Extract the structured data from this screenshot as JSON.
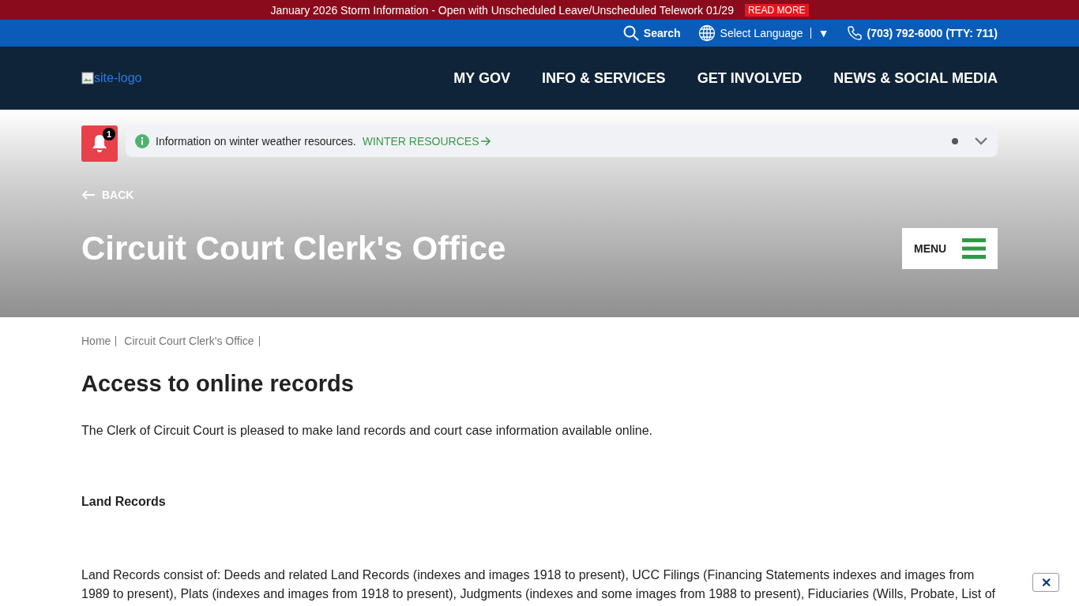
{
  "emergency_bar": {
    "text": "January 2026 Storm Information - Open with Unscheduled Leave/Unscheduled Telework 01/29",
    "link": "READ MORE"
  },
  "utility_bar": {
    "search": "Search",
    "language": "Select Language",
    "language_caret": "▼",
    "phone": "(703) 792-6000 (TTY: 711)"
  },
  "header": {
    "logo_alt": "site-logo",
    "nav": [
      "MY GOV",
      "INFO & SERVICES",
      "GET INVOLVED",
      "NEWS & SOCIAL MEDIA"
    ]
  },
  "alerts": {
    "count": "1",
    "message": "Information on winter weather resources.",
    "link": "WINTER RESOURCES",
    "dots": [
      {
        "selected": true
      }
    ],
    "expanded": false
  },
  "hero": {
    "back": "BACK",
    "title": "Circuit Court Clerk's Office",
    "menu": "MENU"
  },
  "breadcrumbs": [
    "Home",
    "Circuit Court Clerk's Office"
  ],
  "content": {
    "heading": "Access to online records",
    "intro": "The Clerk of Circuit Court is pleased to make land records and court case information available online.",
    "subheading": "Land Records",
    "paragraph": "Land Records consist of: Deeds and related Land Records (indexes and images 1918 to present), UCC Filings (Financing Statements indexes and images from 1989 to present), Plats (indexes and images from 1918 to present), Judgments (indexes and some images from 1988 to present), Fiduciaries (Wills, Probate, List of"
  },
  "close_button": "✕"
}
